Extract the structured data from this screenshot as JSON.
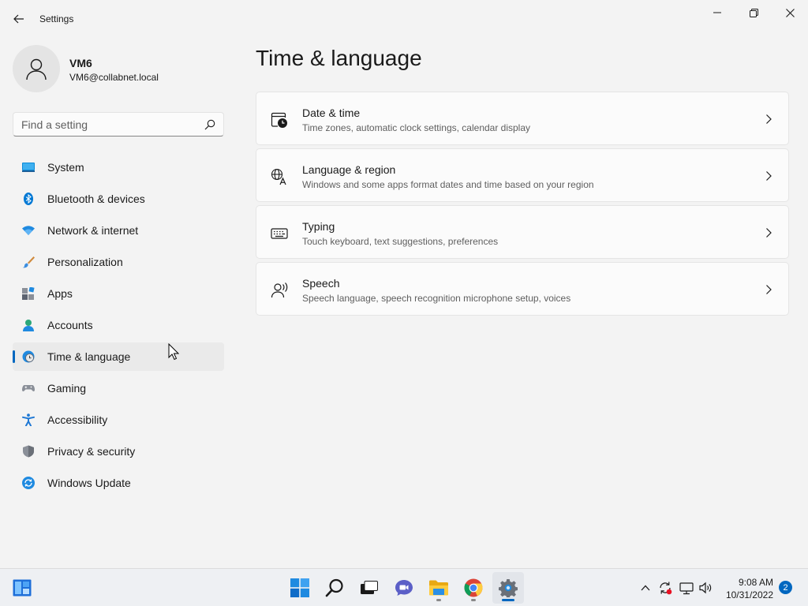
{
  "window": {
    "title": "Settings"
  },
  "profile": {
    "name": "VM6",
    "email": "VM6@collabnet.local"
  },
  "search": {
    "placeholder": "Find a setting"
  },
  "sidebar": {
    "items": [
      {
        "label": "System",
        "icon": "system-icon",
        "selected": false
      },
      {
        "label": "Bluetooth & devices",
        "icon": "bluetooth-icon",
        "selected": false
      },
      {
        "label": "Network & internet",
        "icon": "wifi-icon",
        "selected": false
      },
      {
        "label": "Personalization",
        "icon": "brush-icon",
        "selected": false
      },
      {
        "label": "Apps",
        "icon": "apps-icon",
        "selected": false
      },
      {
        "label": "Accounts",
        "icon": "accounts-icon",
        "selected": false
      },
      {
        "label": "Time & language",
        "icon": "globe-clock-icon",
        "selected": true
      },
      {
        "label": "Gaming",
        "icon": "gamepad-icon",
        "selected": false
      },
      {
        "label": "Accessibility",
        "icon": "accessibility-icon",
        "selected": false
      },
      {
        "label": "Privacy & security",
        "icon": "shield-icon",
        "selected": false
      },
      {
        "label": "Windows Update",
        "icon": "update-icon",
        "selected": false
      }
    ]
  },
  "main": {
    "title": "Time & language",
    "cards": [
      {
        "title": "Date & time",
        "description": "Time zones, automatic clock settings, calendar display",
        "icon": "calendar-clock-icon"
      },
      {
        "title": "Language & region",
        "description": "Windows and some apps format dates and time based on your region",
        "icon": "language-icon"
      },
      {
        "title": "Typing",
        "description": "Touch keyboard, text suggestions, preferences",
        "icon": "keyboard-icon"
      },
      {
        "title": "Speech",
        "description": "Speech language, speech recognition microphone setup, voices",
        "icon": "speech-icon"
      }
    ]
  },
  "taskbar": {
    "time": "9:08 AM",
    "date": "10/31/2022",
    "notification_count": "2",
    "accent": "#0067c0"
  }
}
